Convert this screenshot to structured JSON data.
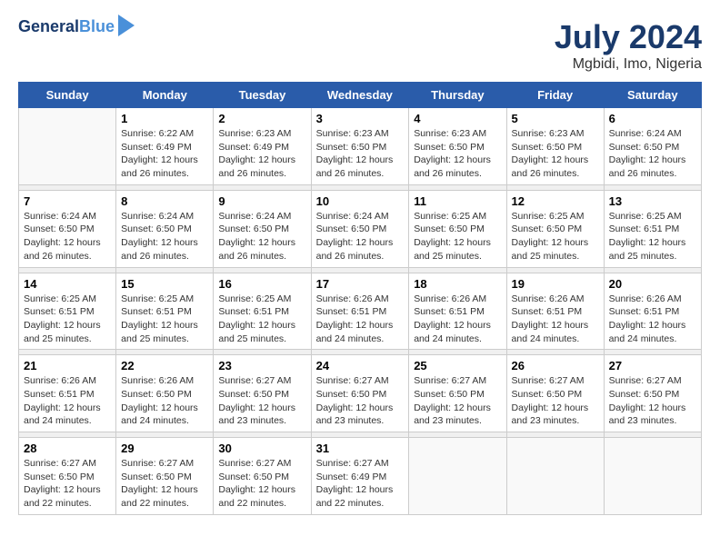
{
  "header": {
    "logo_line1": "General",
    "logo_line2": "Blue",
    "title": "July 2024",
    "subtitle": "Mgbidi, Imo, Nigeria"
  },
  "days_of_week": [
    "Sunday",
    "Monday",
    "Tuesday",
    "Wednesday",
    "Thursday",
    "Friday",
    "Saturday"
  ],
  "weeks": [
    [
      {
        "num": "",
        "info": ""
      },
      {
        "num": "1",
        "info": "Sunrise: 6:22 AM\nSunset: 6:49 PM\nDaylight: 12 hours\nand 26 minutes."
      },
      {
        "num": "2",
        "info": "Sunrise: 6:23 AM\nSunset: 6:49 PM\nDaylight: 12 hours\nand 26 minutes."
      },
      {
        "num": "3",
        "info": "Sunrise: 6:23 AM\nSunset: 6:50 PM\nDaylight: 12 hours\nand 26 minutes."
      },
      {
        "num": "4",
        "info": "Sunrise: 6:23 AM\nSunset: 6:50 PM\nDaylight: 12 hours\nand 26 minutes."
      },
      {
        "num": "5",
        "info": "Sunrise: 6:23 AM\nSunset: 6:50 PM\nDaylight: 12 hours\nand 26 minutes."
      },
      {
        "num": "6",
        "info": "Sunrise: 6:24 AM\nSunset: 6:50 PM\nDaylight: 12 hours\nand 26 minutes."
      }
    ],
    [
      {
        "num": "7",
        "info": "Sunrise: 6:24 AM\nSunset: 6:50 PM\nDaylight: 12 hours\nand 26 minutes."
      },
      {
        "num": "8",
        "info": "Sunrise: 6:24 AM\nSunset: 6:50 PM\nDaylight: 12 hours\nand 26 minutes."
      },
      {
        "num": "9",
        "info": "Sunrise: 6:24 AM\nSunset: 6:50 PM\nDaylight: 12 hours\nand 26 minutes."
      },
      {
        "num": "10",
        "info": "Sunrise: 6:24 AM\nSunset: 6:50 PM\nDaylight: 12 hours\nand 26 minutes."
      },
      {
        "num": "11",
        "info": "Sunrise: 6:25 AM\nSunset: 6:50 PM\nDaylight: 12 hours\nand 25 minutes."
      },
      {
        "num": "12",
        "info": "Sunrise: 6:25 AM\nSunset: 6:50 PM\nDaylight: 12 hours\nand 25 minutes."
      },
      {
        "num": "13",
        "info": "Sunrise: 6:25 AM\nSunset: 6:51 PM\nDaylight: 12 hours\nand 25 minutes."
      }
    ],
    [
      {
        "num": "14",
        "info": "Sunrise: 6:25 AM\nSunset: 6:51 PM\nDaylight: 12 hours\nand 25 minutes."
      },
      {
        "num": "15",
        "info": "Sunrise: 6:25 AM\nSunset: 6:51 PM\nDaylight: 12 hours\nand 25 minutes."
      },
      {
        "num": "16",
        "info": "Sunrise: 6:25 AM\nSunset: 6:51 PM\nDaylight: 12 hours\nand 25 minutes."
      },
      {
        "num": "17",
        "info": "Sunrise: 6:26 AM\nSunset: 6:51 PM\nDaylight: 12 hours\nand 24 minutes."
      },
      {
        "num": "18",
        "info": "Sunrise: 6:26 AM\nSunset: 6:51 PM\nDaylight: 12 hours\nand 24 minutes."
      },
      {
        "num": "19",
        "info": "Sunrise: 6:26 AM\nSunset: 6:51 PM\nDaylight: 12 hours\nand 24 minutes."
      },
      {
        "num": "20",
        "info": "Sunrise: 6:26 AM\nSunset: 6:51 PM\nDaylight: 12 hours\nand 24 minutes."
      }
    ],
    [
      {
        "num": "21",
        "info": "Sunrise: 6:26 AM\nSunset: 6:51 PM\nDaylight: 12 hours\nand 24 minutes."
      },
      {
        "num": "22",
        "info": "Sunrise: 6:26 AM\nSunset: 6:50 PM\nDaylight: 12 hours\nand 24 minutes."
      },
      {
        "num": "23",
        "info": "Sunrise: 6:27 AM\nSunset: 6:50 PM\nDaylight: 12 hours\nand 23 minutes."
      },
      {
        "num": "24",
        "info": "Sunrise: 6:27 AM\nSunset: 6:50 PM\nDaylight: 12 hours\nand 23 minutes."
      },
      {
        "num": "25",
        "info": "Sunrise: 6:27 AM\nSunset: 6:50 PM\nDaylight: 12 hours\nand 23 minutes."
      },
      {
        "num": "26",
        "info": "Sunrise: 6:27 AM\nSunset: 6:50 PM\nDaylight: 12 hours\nand 23 minutes."
      },
      {
        "num": "27",
        "info": "Sunrise: 6:27 AM\nSunset: 6:50 PM\nDaylight: 12 hours\nand 23 minutes."
      }
    ],
    [
      {
        "num": "28",
        "info": "Sunrise: 6:27 AM\nSunset: 6:50 PM\nDaylight: 12 hours\nand 22 minutes."
      },
      {
        "num": "29",
        "info": "Sunrise: 6:27 AM\nSunset: 6:50 PM\nDaylight: 12 hours\nand 22 minutes."
      },
      {
        "num": "30",
        "info": "Sunrise: 6:27 AM\nSunset: 6:50 PM\nDaylight: 12 hours\nand 22 minutes."
      },
      {
        "num": "31",
        "info": "Sunrise: 6:27 AM\nSunset: 6:49 PM\nDaylight: 12 hours\nand 22 minutes."
      },
      {
        "num": "",
        "info": ""
      },
      {
        "num": "",
        "info": ""
      },
      {
        "num": "",
        "info": ""
      }
    ]
  ]
}
